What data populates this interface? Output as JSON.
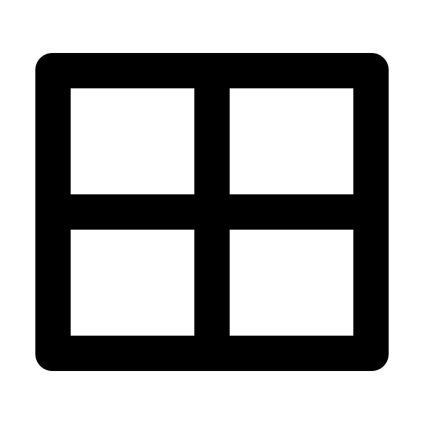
{
  "icon": {
    "name": "table-grid-icon",
    "color": "#000000",
    "background": "#ffffff"
  }
}
